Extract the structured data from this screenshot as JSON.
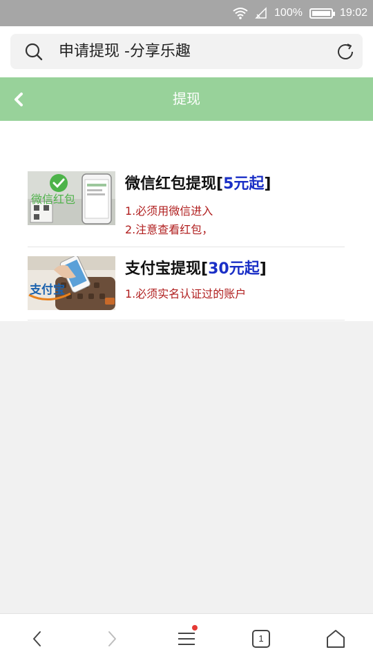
{
  "status_bar": {
    "battery": "100%",
    "time": "19:02",
    "icons": [
      "wifi-icon",
      "signal-icon",
      "battery-icon"
    ]
  },
  "address_bar": {
    "page_title": "申请提现 -分享乐趣",
    "icons": [
      "search-icon",
      "reload-icon"
    ]
  },
  "header": {
    "title": "提现",
    "back_icon": "chevron-left-icon",
    "bg_color": "#98d29a"
  },
  "withdraw_options": [
    {
      "title": "微信红包提现",
      "bracket_open": "[",
      "min_amount": "5元起",
      "bracket_close": "]",
      "notes": [
        "1.必须用微信进入",
        "2.注意查看红包，"
      ],
      "thumb_text": "微信红包"
    },
    {
      "title": "支付宝提现",
      "bracket_open": "[",
      "min_amount": "30元起",
      "bracket_close": "]",
      "notes": [
        "1.必须实名认证过的账户"
      ],
      "thumb_text": "支付宝"
    }
  ],
  "bottom_nav": {
    "tab_count": "1",
    "icons": [
      "back-icon",
      "forward-icon",
      "menu-icon",
      "tabs-icon",
      "home-icon"
    ]
  },
  "colors": {
    "accent_green": "#98d29a",
    "price_blue": "#1a2fc6",
    "note_red": "#b01e1e"
  }
}
